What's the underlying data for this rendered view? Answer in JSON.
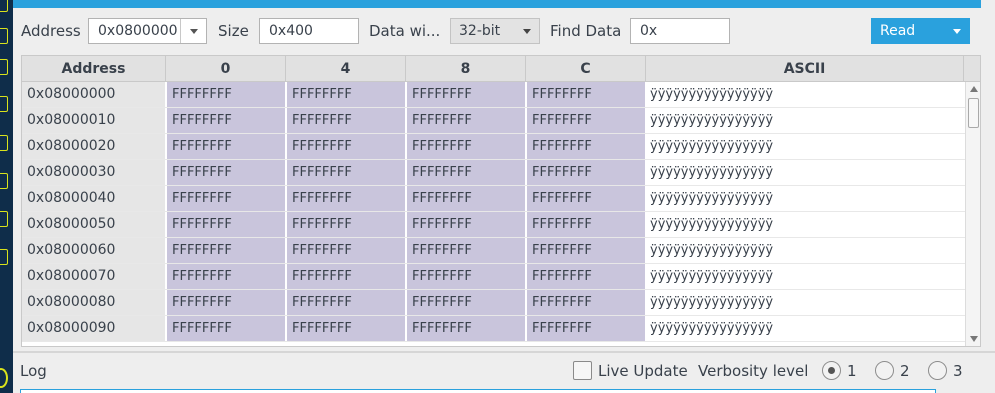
{
  "colors": {
    "accent": "#2aa1dd",
    "sidebar": "#0f2d4a",
    "sidebar_icon": "#d9e31c",
    "data_cell": "#c9c5dc",
    "address_cell": "#e6e6e6"
  },
  "toolbar": {
    "address_label": "Address",
    "address_value": "0x0800000",
    "size_label": "Size",
    "size_value": "0x400",
    "data_width_label": "Data wi...",
    "data_width_value": "32-bit",
    "find_label": "Find Data",
    "find_value": "0x",
    "read_label": "Read"
  },
  "grid": {
    "headers": [
      "Address",
      "0",
      "4",
      "8",
      "C",
      "ASCII"
    ],
    "rows": [
      {
        "address": "0x08000000",
        "c0": "FFFFFFFF",
        "c4": "FFFFFFFF",
        "c8": "FFFFFFFF",
        "cC": "FFFFFFFF",
        "ascii": "ÿÿÿÿÿÿÿÿÿÿÿÿÿÿÿÿ"
      },
      {
        "address": "0x08000010",
        "c0": "FFFFFFFF",
        "c4": "FFFFFFFF",
        "c8": "FFFFFFFF",
        "cC": "FFFFFFFF",
        "ascii": "ÿÿÿÿÿÿÿÿÿÿÿÿÿÿÿÿ"
      },
      {
        "address": "0x08000020",
        "c0": "FFFFFFFF",
        "c4": "FFFFFFFF",
        "c8": "FFFFFFFF",
        "cC": "FFFFFFFF",
        "ascii": "ÿÿÿÿÿÿÿÿÿÿÿÿÿÿÿÿ"
      },
      {
        "address": "0x08000030",
        "c0": "FFFFFFFF",
        "c4": "FFFFFFFF",
        "c8": "FFFFFFFF",
        "cC": "FFFFFFFF",
        "ascii": "ÿÿÿÿÿÿÿÿÿÿÿÿÿÿÿÿ"
      },
      {
        "address": "0x08000040",
        "c0": "FFFFFFFF",
        "c4": "FFFFFFFF",
        "c8": "FFFFFFFF",
        "cC": "FFFFFFFF",
        "ascii": "ÿÿÿÿÿÿÿÿÿÿÿÿÿÿÿÿ"
      },
      {
        "address": "0x08000050",
        "c0": "FFFFFFFF",
        "c4": "FFFFFFFF",
        "c8": "FFFFFFFF",
        "cC": "FFFFFFFF",
        "ascii": "ÿÿÿÿÿÿÿÿÿÿÿÿÿÿÿÿ"
      },
      {
        "address": "0x08000060",
        "c0": "FFFFFFFF",
        "c4": "FFFFFFFF",
        "c8": "FFFFFFFF",
        "cC": "FFFFFFFF",
        "ascii": "ÿÿÿÿÿÿÿÿÿÿÿÿÿÿÿÿ"
      },
      {
        "address": "0x08000070",
        "c0": "FFFFFFFF",
        "c4": "FFFFFFFF",
        "c8": "FFFFFFFF",
        "cC": "FFFFFFFF",
        "ascii": "ÿÿÿÿÿÿÿÿÿÿÿÿÿÿÿÿ"
      },
      {
        "address": "0x08000080",
        "c0": "FFFFFFFF",
        "c4": "FFFFFFFF",
        "c8": "FFFFFFFF",
        "cC": "FFFFFFFF",
        "ascii": "ÿÿÿÿÿÿÿÿÿÿÿÿÿÿÿÿ"
      },
      {
        "address": "0x08000090",
        "c0": "FFFFFFFF",
        "c4": "FFFFFFFF",
        "c8": "FFFFFFFF",
        "cC": "FFFFFFFF",
        "ascii": "ÿÿÿÿÿÿÿÿÿÿÿÿÿÿÿÿ"
      }
    ]
  },
  "log": {
    "label": "Log",
    "live_update_label": "Live Update",
    "verbosity_label": "Verbosity level",
    "verbosity_options": [
      "1",
      "2",
      "3"
    ],
    "verbosity_selected": "1"
  }
}
